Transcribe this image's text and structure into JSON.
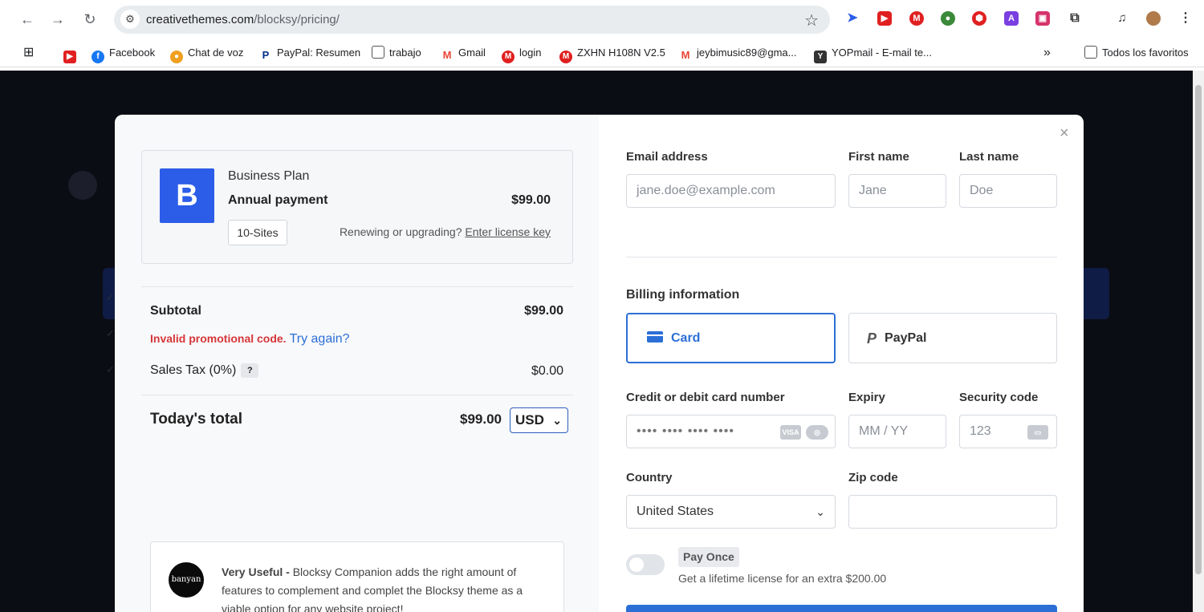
{
  "browser": {
    "url_host": "creativethemes.com",
    "url_path": "/blocksy/pricing/",
    "bookmarks": [
      {
        "label": "Facebook"
      },
      {
        "label": "Chat de voz"
      },
      {
        "label": "PayPal: Resumen"
      },
      {
        "label": "trabajo"
      },
      {
        "label": "Gmail"
      },
      {
        "label": "login"
      },
      {
        "label": "ZXHN H108N V2.5"
      },
      {
        "label": "jeybimusic89@gma..."
      },
      {
        "label": "YOPmail - E-mail te..."
      }
    ],
    "overflow": "»",
    "all_favorites": "Todos los favoritos"
  },
  "plan": {
    "name": "Business Plan",
    "payment": "Annual payment",
    "price": "$99.00",
    "sites": "10-Sites",
    "renew_text": "Renewing or upgrading?",
    "renew_link": "Enter license key",
    "logo_letter": "B"
  },
  "summary": {
    "subtotal_label": "Subtotal",
    "subtotal_value": "$99.00",
    "promo_error": "Invalid promotional code.",
    "promo_retry": "Try again?",
    "tax_label": "Sales Tax (0%)",
    "tax_help": "?",
    "tax_value": "$0.00",
    "total_label": "Today's total",
    "total_value": "$99.00",
    "currency": "USD"
  },
  "testimonial": {
    "avatar_text": "banyan",
    "lead": "Very Useful - ",
    "body": "Blocksy Companion adds the right amount of features to complement and complet the Blocksy theme as a viable option for any website project!"
  },
  "form": {
    "email_label": "Email address",
    "email_placeholder": "jane.doe@example.com",
    "first_label": "First name",
    "first_placeholder": "Jane",
    "last_label": "Last name",
    "last_placeholder": "Doe",
    "billing_label": "Billing information",
    "method_card": "Card",
    "method_paypal": "PayPal",
    "card_label": "Credit or debit card number",
    "card_placeholder": "•••• •••• •••• ••••",
    "expiry_label": "Expiry",
    "expiry_placeholder": "MM / YY",
    "cvc_label": "Security code",
    "cvc_placeholder": "123",
    "country_label": "Country",
    "country_value": "United States",
    "zip_label": "Zip code",
    "pay_once": "Pay Once",
    "lifetime": "Get a lifetime license for an extra $200.00"
  },
  "colors": {
    "accent": "#2b6fd6",
    "brand": "#2b5de8",
    "error": "#d63638"
  }
}
